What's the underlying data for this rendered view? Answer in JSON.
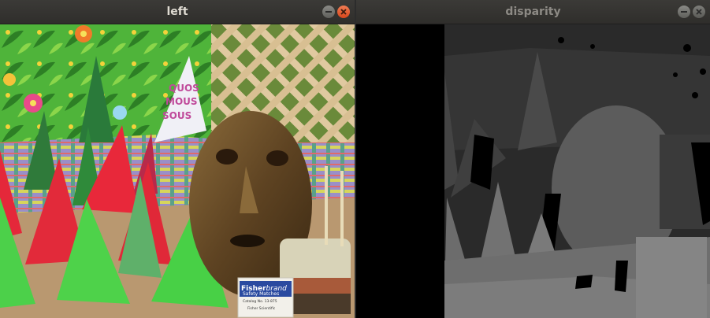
{
  "windows": {
    "left": {
      "title": "left",
      "state": "focused",
      "title_color": "#dfdbd2",
      "image_label": {
        "brand_bold": "Fisher",
        "brand_italic": "brand",
        "product": "Safety Matches",
        "catalog": "Catalog No. 13-875",
        "maker": "Fisher Scientific"
      }
    },
    "right": {
      "title": "disparity",
      "state": "unfocused",
      "title_color": "#8d8a85"
    }
  },
  "colors": {
    "close_active": "#e9541f",
    "titlebar": "#33322f"
  }
}
